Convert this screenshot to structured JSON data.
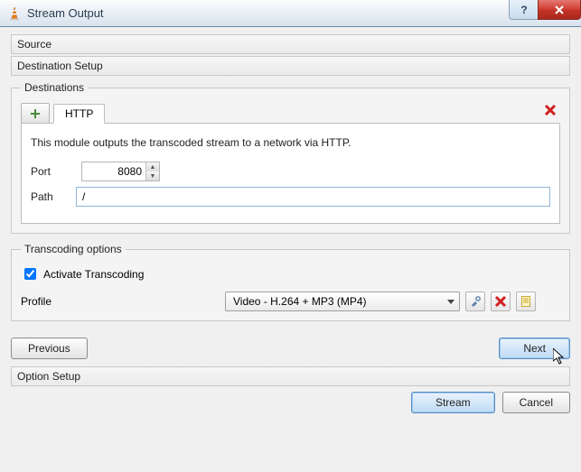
{
  "window": {
    "title": "Stream Output"
  },
  "sections": {
    "source": "Source",
    "destination": "Destination Setup",
    "option": "Option Setup"
  },
  "destinations": {
    "legend": "Destinations",
    "tab_label": "HTTP",
    "description": "This module outputs the transcoded stream to a network via HTTP.",
    "port_label": "Port",
    "port_value": "8080",
    "path_label": "Path",
    "path_value": "/"
  },
  "transcoding": {
    "legend": "Transcoding options",
    "activate_label": "Activate Transcoding",
    "activate_checked": true,
    "profile_label": "Profile",
    "profile_value": "Video - H.264 + MP3 (MP4)"
  },
  "nav": {
    "previous": "Previous",
    "next": "Next"
  },
  "bottom": {
    "stream": "Stream",
    "cancel": "Cancel"
  }
}
